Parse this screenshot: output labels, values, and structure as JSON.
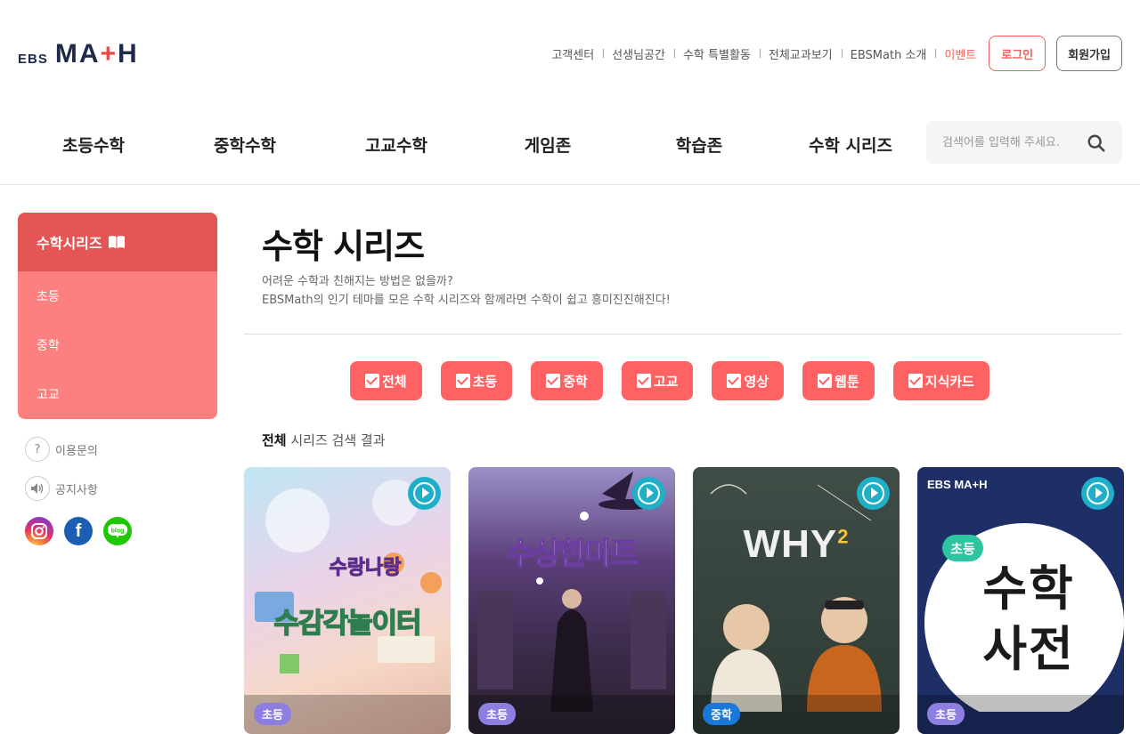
{
  "logo": {
    "ebs": "EBS",
    "math": "MA",
    "plus": "+",
    "h": "H",
    "full": "EBS MATH"
  },
  "util_links": [
    "고객센터",
    "선생님공간",
    "수학 특별활동",
    "전체교과보기",
    "EBSMath 소개",
    "이벤트"
  ],
  "login_label": "로그인",
  "join_label": "회원가입",
  "gnb": [
    "초등수학",
    "중학수학",
    "고교수학",
    "게임존",
    "학습존",
    "수학 시리즈"
  ],
  "search": {
    "placeholder": "검색어를 입력해 주세요."
  },
  "sidebar": {
    "title": "수학시리즈",
    "items": [
      "초등",
      "중학",
      "고교"
    ],
    "links": [
      "이용문의",
      "공지사항"
    ],
    "sns": [
      "instagram",
      "facebook",
      "blog"
    ]
  },
  "main": {
    "title": "수학 시리즈",
    "desc_line1": "어려운 수학과 친해지는 방법은 없을까?",
    "desc_line2": "EBSMath의 인기 테마를 모은 수학 시리즈와 함께라면 수학이 쉽고 흥미진진해진다!",
    "filters": [
      "전체",
      "초등",
      "중학",
      "고교",
      "영상",
      "웹툰",
      "지식카드"
    ],
    "result_bold": "전체",
    "result_rest": " 시리즈 검색 결과"
  },
  "cards": [
    {
      "badge": "초등",
      "title_line1": "수랑나랑",
      "title_line2": "수감각놀이터"
    },
    {
      "badge": "초등",
      "title_line1": "수상한마트"
    },
    {
      "badge": "중학",
      "title_line1": "WHY",
      "sup": "2"
    },
    {
      "badge": "초등",
      "title_line1": "초등",
      "title_line2": "수학",
      "title_line3": "사전",
      "brand": "EBS MA+H"
    }
  ],
  "colors": {
    "accent": "#ff6262",
    "accent_dark": "#e45555",
    "sidebar_bg": "#fd8080",
    "play": "#1eb0c9",
    "badge_elem": "#8d7fe0",
    "badge_mid": "#1a78d8"
  }
}
